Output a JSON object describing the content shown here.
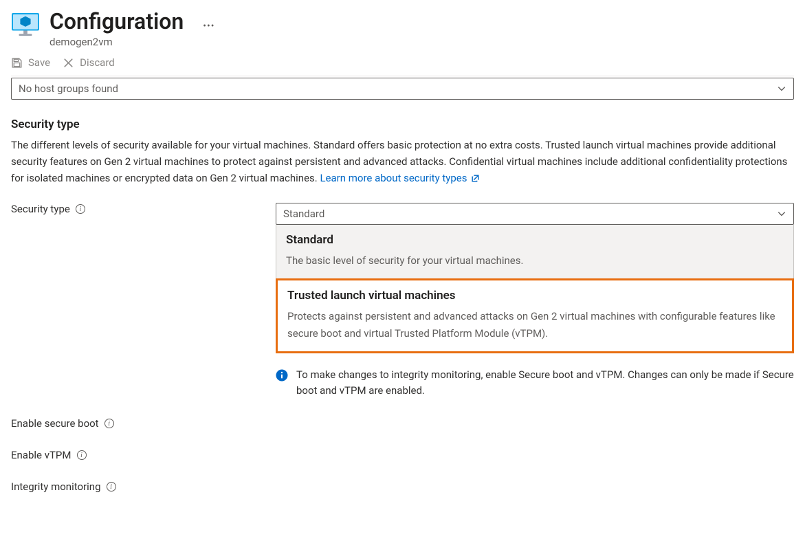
{
  "header": {
    "title": "Configuration",
    "subtitle": "demogen2vm"
  },
  "toolbar": {
    "save": "Save",
    "discard": "Discard"
  },
  "hostgroup": {
    "selected": "No host groups found"
  },
  "section": {
    "title": "Security type",
    "description": "The different levels of security available for your virtual machines. Standard offers basic protection at no extra costs. Trusted launch virtual machines provide additional security features on Gen 2 virtual machines to protect against persistent and advanced attacks. Confidential virtual machines include additional confidentiality protections for isolated machines or encrypted data on Gen 2 virtual machines.",
    "learn_more": "Learn more about security types"
  },
  "fields": {
    "security_type": {
      "label": "Security type"
    },
    "secure_boot": {
      "label": "Enable secure boot"
    },
    "vtpm": {
      "label": "Enable vTPM"
    },
    "integrity": {
      "label": "Integrity monitoring"
    }
  },
  "security_select": {
    "value": "Standard",
    "options": [
      {
        "title": "Standard",
        "desc": "The basic level of security for your virtual machines."
      },
      {
        "title": "Trusted launch virtual machines",
        "desc": "Protects against persistent and advanced attacks on Gen 2 virtual machines with configurable features like secure boot and virtual Trusted Platform Module (vTPM)."
      }
    ]
  },
  "integrity_note": "To make changes to integrity monitoring, enable Secure boot and vTPM. Changes can only be made if Secure boot and vTPM are enabled."
}
